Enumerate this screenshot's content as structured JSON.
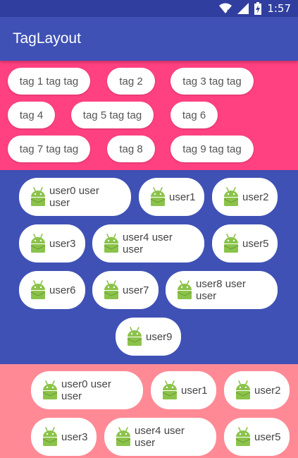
{
  "status_bar": {
    "time": "1:57",
    "icons": [
      "wifi-icon",
      "signal-icon",
      "battery-charging-icon"
    ]
  },
  "app_bar": {
    "title": "TagLayout"
  },
  "colors": {
    "status_bar": "#303f9f",
    "app_bar": "#3f51b5",
    "section_one": "#ff4081",
    "section_two": "#3f51b5",
    "section_three": "#ff8a95",
    "android_green": "#8bc34a"
  },
  "tags": [
    "tag 1 tag tag",
    "tag 2",
    "tag 3 tag tag",
    "tag 4",
    "tag 5 tag tag",
    "tag 6",
    "tag 7 tag tag",
    "tag 8",
    "tag 9 tag tag"
  ],
  "users_centered": [
    "user0 user user",
    "user1",
    "user2",
    "user3",
    "user4 user user",
    "user5",
    "user6",
    "user7",
    "user8 user user",
    "user9"
  ],
  "users_right": [
    "user0 user user",
    "user1",
    "user2",
    "user3",
    "user4 user user",
    "user5"
  ],
  "chip_icon": "android-icon"
}
